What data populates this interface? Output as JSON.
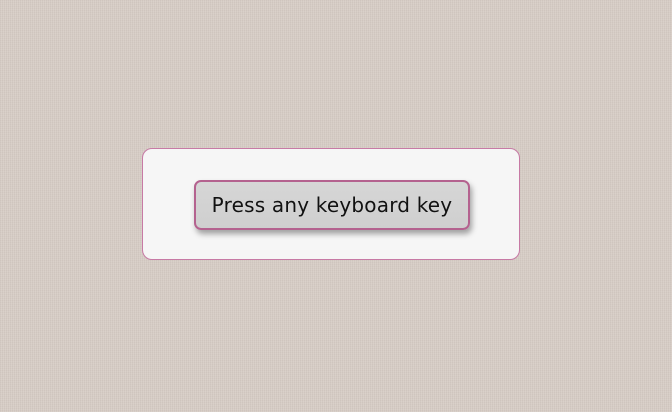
{
  "prompt": {
    "label": "Press any keyboard key"
  },
  "colors": {
    "background": "#d7cdc6",
    "card_background": "#f6f6f6",
    "accent_border": "#b4628f",
    "button_fill": "#d2d2d2"
  }
}
